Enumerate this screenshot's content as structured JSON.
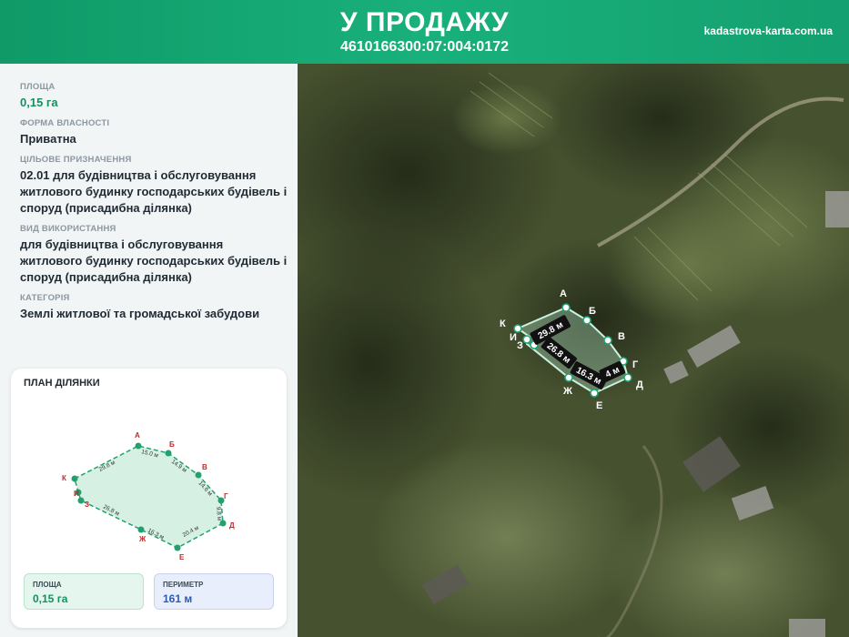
{
  "header": {
    "title": "У ПРОДАЖУ",
    "cadastral_number": "4610166300:07:004:0172",
    "site": "kadastrova-karta.com.ua"
  },
  "info": {
    "area_label": "ПЛОЩА",
    "area_value": "0,15 га",
    "ownership_label": "ФОРМА ВЛАСНОСТІ",
    "ownership_value": "Приватна",
    "purpose_label": "ЦІЛЬОВЕ ПРИЗНАЧЕННЯ",
    "purpose_value": "02.01 для будівництва і обслуговування житлового будинку господарських будівель і споруд (присадибна ділянка)",
    "usage_label": "ВИД ВИКОРИСТАННЯ",
    "usage_value": "для будівництва і обслуговування житлового будинку господарських будівель і споруд (присадибна ділянка)",
    "category_label": "КАТЕГОРІЯ",
    "category_value": "Землі житлової та громадської забудови"
  },
  "plan": {
    "title": "ПЛАН ДІЛЯНКИ",
    "vertices": [
      "А",
      "Б",
      "В",
      "Г",
      "Д",
      "Е",
      "Ж",
      "З",
      "И",
      "К"
    ],
    "edges": [
      "29.8 м",
      "15.0 м",
      "14.9 м",
      "14.6 м",
      "9.8 м",
      "20.4 м",
      "16.3 м",
      "26.8 м"
    ],
    "area_label": "ПЛОЩА",
    "area_value": "0,15 га",
    "perimeter_label": "ПЕРИМЕТР",
    "perimeter_value": "161 м"
  },
  "map": {
    "vertices": [
      "А",
      "Б",
      "В",
      "Г",
      "Д",
      "Е",
      "Ж",
      "З",
      "И",
      "К"
    ],
    "edges": [
      "29.8 м",
      "26.8 м",
      "16.3 м",
      "4 м"
    ]
  },
  "colors": {
    "brand": "#14a070",
    "plot_line": "#1aa571",
    "plot_fill": "#c9eedd"
  }
}
